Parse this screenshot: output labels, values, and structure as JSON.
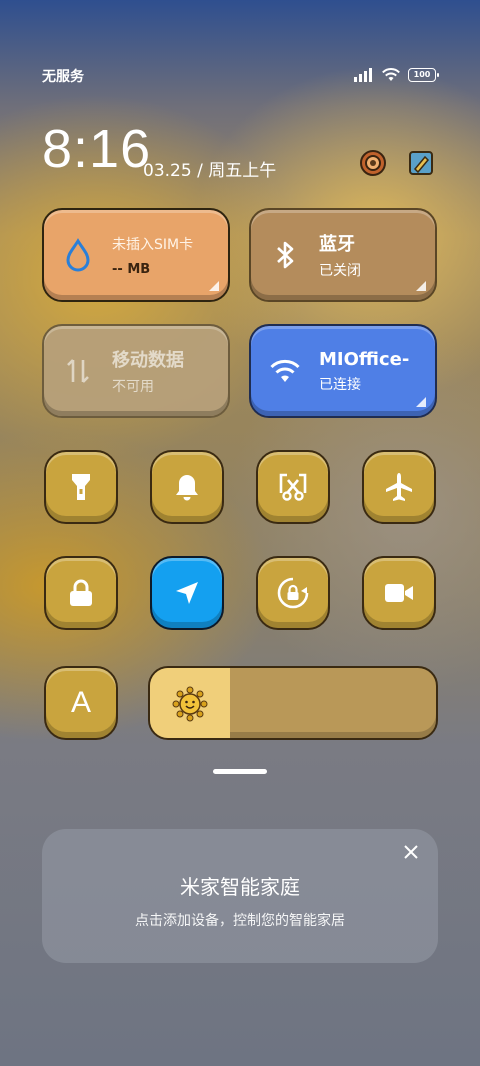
{
  "status_bar": {
    "carrier": "无服务",
    "battery": "100"
  },
  "clock": {
    "time": "8:16",
    "date": "03.25 / 周五上午"
  },
  "tiles": {
    "sim": {
      "title": "未插入SIM卡",
      "value": "-- MB"
    },
    "bluetooth": {
      "title": "蓝牙",
      "status": "已关闭"
    },
    "mobile_data": {
      "title": "移动数据",
      "status": "不可用"
    },
    "wifi": {
      "title": "MIOffice-",
      "status": "已连接"
    }
  },
  "toggles": [
    {
      "icon": "flashlight-icon",
      "active": false
    },
    {
      "icon": "bell-icon",
      "active": false
    },
    {
      "icon": "screenshot-icon",
      "active": false
    },
    {
      "icon": "airplane-icon",
      "active": false
    },
    {
      "icon": "lock-icon",
      "active": false
    },
    {
      "icon": "location-icon",
      "active": true
    },
    {
      "icon": "rotation-lock-icon",
      "active": false
    },
    {
      "icon": "video-camera-icon",
      "active": false
    }
  ],
  "auto_brightness_label": "A",
  "brightness_level": 0.28,
  "smart_home_card": {
    "title": "米家智能家庭",
    "subtitle": "点击添加设备，控制您的智能家居"
  },
  "colors": {
    "toggle": "#c9a43e",
    "active_toggle": "#14a0f0",
    "wifi_tile": "#4f7fe6",
    "sim_tile": "#e8a469"
  }
}
